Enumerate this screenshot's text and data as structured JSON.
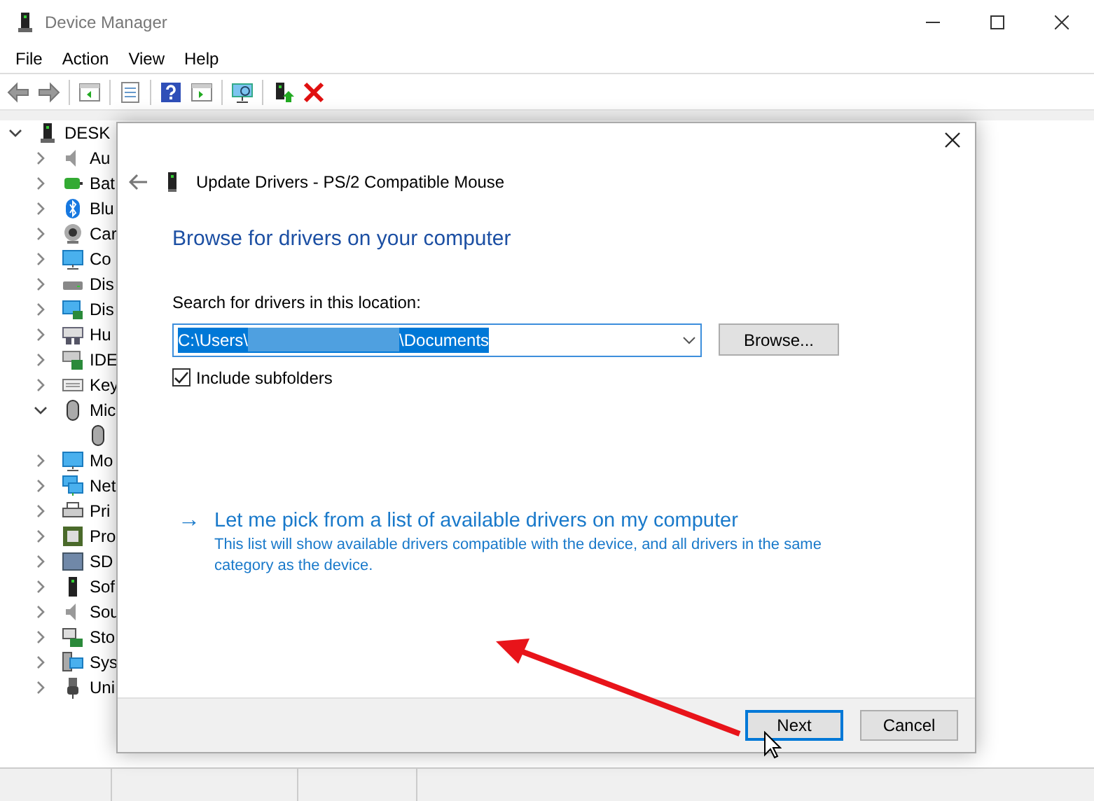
{
  "window": {
    "title": "Device Manager"
  },
  "menu": [
    "File",
    "Action",
    "View",
    "Help"
  ],
  "tree": {
    "label": "DESK",
    "expanded": true,
    "children": [
      {
        "label": "Au",
        "expanded": false
      },
      {
        "label": "Bat",
        "expanded": false
      },
      {
        "label": "Blu",
        "expanded": false
      },
      {
        "label": "Car",
        "expanded": false
      },
      {
        "label": "Co",
        "expanded": false
      },
      {
        "label": "Dis",
        "expanded": false
      },
      {
        "label": "Dis",
        "expanded": false
      },
      {
        "label": "Hu",
        "expanded": false
      },
      {
        "label": "IDE",
        "expanded": false
      },
      {
        "label": "Key",
        "expanded": false
      },
      {
        "label": "Mic",
        "expanded": true,
        "children": [
          {
            "kind": "device"
          }
        ]
      },
      {
        "label": "Mo",
        "expanded": false
      },
      {
        "label": "Net",
        "expanded": false
      },
      {
        "label": "Pri",
        "expanded": false
      },
      {
        "label": "Pro",
        "expanded": false
      },
      {
        "label": "SD",
        "expanded": false
      },
      {
        "label": "Sof",
        "expanded": false
      },
      {
        "label": "Sou",
        "expanded": false
      },
      {
        "label": "Sto",
        "expanded": false
      },
      {
        "label": "Sys",
        "expanded": false
      },
      {
        "label": "Uni",
        "expanded": false
      }
    ]
  },
  "dialog": {
    "title": "Update Drivers - PS/2 Compatible Mouse",
    "heading": "Browse for drivers on your computer",
    "search_label": "Search for drivers in this location:",
    "path_start": "C:\\Users\\",
    "path_end": "\\Documents",
    "browse_button": "Browse...",
    "include_subfolders": {
      "label": "Include subfolders",
      "checked": true
    },
    "pick_link": {
      "arrow": "→",
      "title": "Let me pick from a list of available drivers on my computer",
      "description": "This list will show available drivers compatible with the device, and all drivers in the same category as the device."
    },
    "buttons": [
      {
        "label": "Next",
        "default": true
      },
      {
        "label": "Cancel",
        "default": false
      }
    ]
  }
}
